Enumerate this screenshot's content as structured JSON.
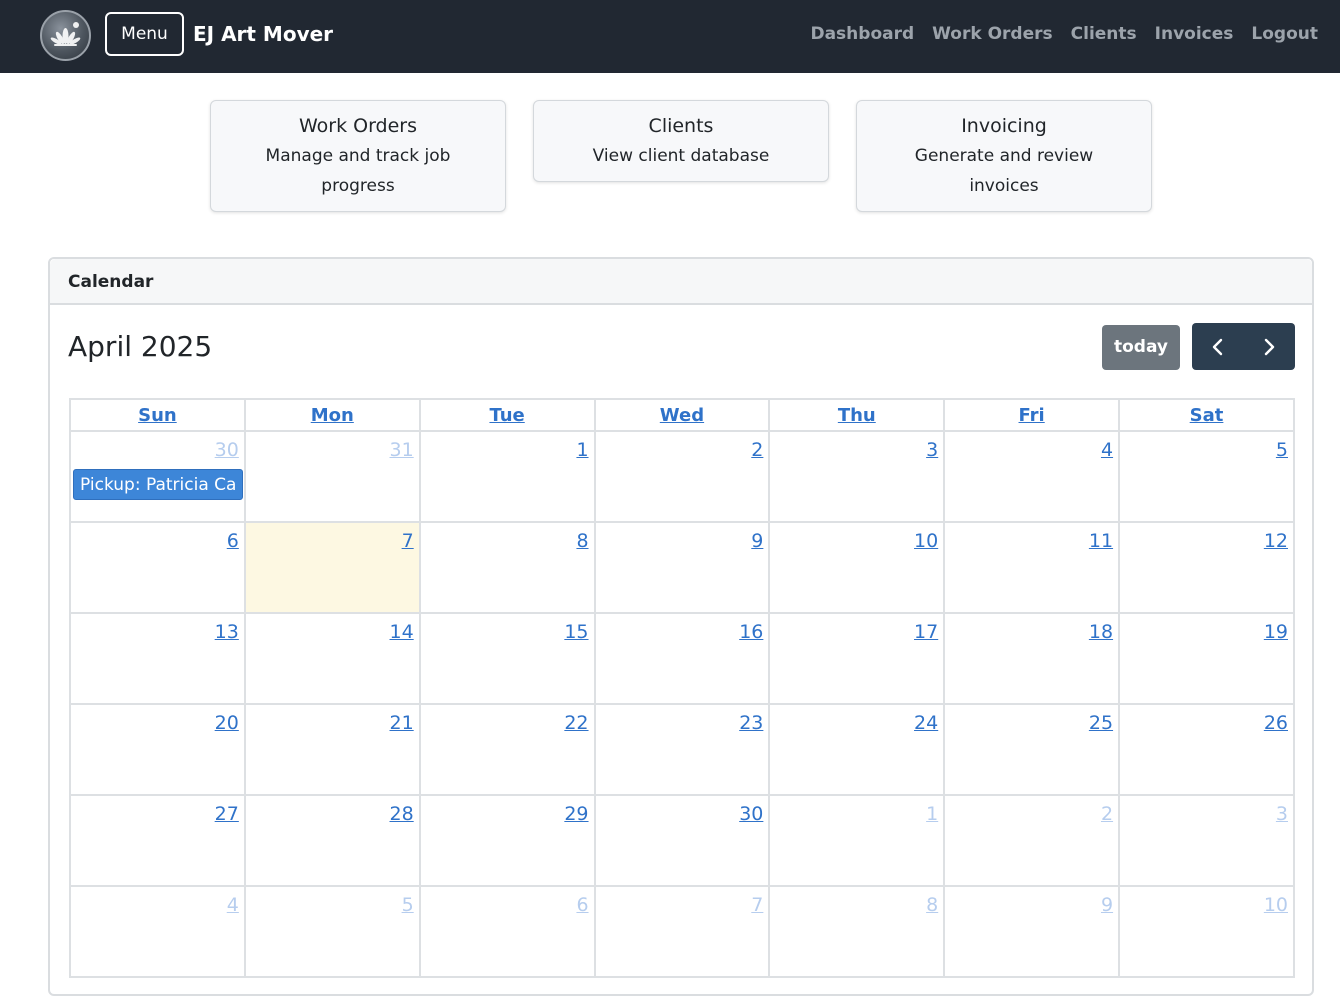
{
  "navbar": {
    "menu_label": "Menu",
    "brand": "EJ Art Mover",
    "links": [
      "Dashboard",
      "Work Orders",
      "Clients",
      "Invoices",
      "Logout"
    ]
  },
  "cards": [
    {
      "title": "Work Orders",
      "description": "Manage and track job progress"
    },
    {
      "title": "Clients",
      "description": "View client database"
    },
    {
      "title": "Invoicing",
      "description": "Generate and review invoices"
    }
  ],
  "calendar": {
    "header": "Calendar",
    "title": "April 2025",
    "today_label": "today",
    "prev_icon": "chevron-left",
    "next_icon": "chevron-right",
    "weekdays": [
      "Sun",
      "Mon",
      "Tue",
      "Wed",
      "Thu",
      "Fri",
      "Sat"
    ],
    "weeks": [
      [
        "30",
        "31",
        "1",
        "2",
        "3",
        "4",
        "5"
      ],
      [
        "6",
        "7",
        "8",
        "9",
        "10",
        "11",
        "12"
      ],
      [
        "13",
        "14",
        "15",
        "16",
        "17",
        "18",
        "19"
      ],
      [
        "20",
        "21",
        "22",
        "23",
        "24",
        "25",
        "26"
      ],
      [
        "27",
        "28",
        "29",
        "30",
        "1",
        "2",
        "3"
      ],
      [
        "4",
        "5",
        "6",
        "7",
        "8",
        "9",
        "10"
      ]
    ],
    "event": {
      "label": "Pickup: Patricia Ca",
      "day": "30 (Mar)"
    },
    "today_highlight": "7"
  },
  "colors": {
    "navbar_bg": "#212832",
    "link_blue": "#2f72c9",
    "event_blue": "#3d86d8",
    "today_bg": "#fdf8e2"
  }
}
